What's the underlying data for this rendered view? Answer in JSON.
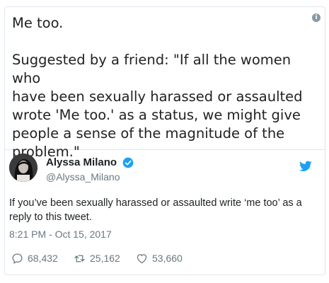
{
  "embedded_image": {
    "line1": "Me too.",
    "lines": [
      "Suggested by a friend: \"If all the women who",
      "have been sexually harassed or assaulted",
      "wrote 'Me too.' as a status, we might give",
      "people a sense of the magnitude of the",
      "problem.\""
    ],
    "info_icon": "info-icon"
  },
  "author": {
    "display_name": "Alyssa Milano",
    "handle": "@Alyssa_Milano",
    "verified_icon": "verified-badge-icon",
    "logo_icon": "twitter-bird-icon"
  },
  "tweet": {
    "text": "If you’ve been sexually harassed or assaulted write ‘me too’ as a reply to this tweet.",
    "timestamp": "8:21 PM - Oct 15, 2017"
  },
  "actions": {
    "replies": "68,432",
    "retweets": "25,162",
    "likes": "53,660"
  },
  "colors": {
    "accent_blue": "#1da1f2",
    "muted": "#697882",
    "border": "#e1e8ed"
  }
}
